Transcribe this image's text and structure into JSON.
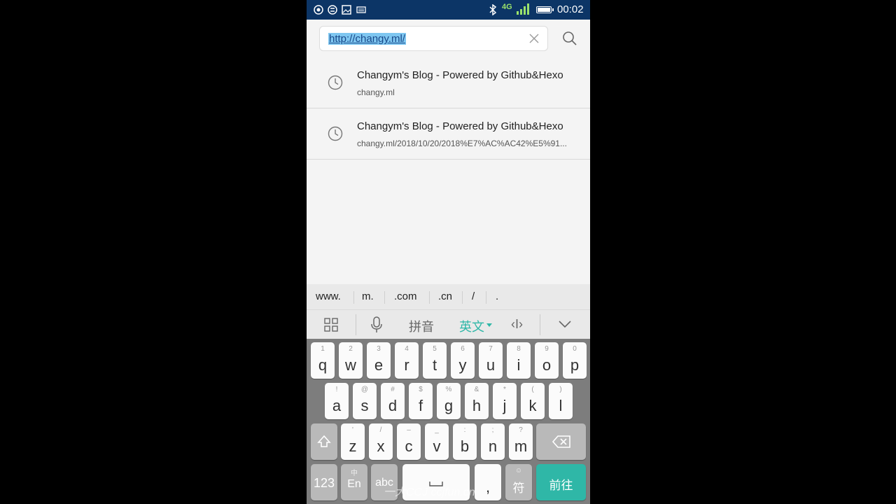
{
  "status_bar": {
    "network": "4G",
    "time": "00:02",
    "battery_level": 1.0
  },
  "address_bar": {
    "url": "http://changy.ml/"
  },
  "suggestions": [
    {
      "title": "Changym's Blog - Powered by Github&Hexo",
      "url": "changy.ml"
    },
    {
      "title": "Changym's Blog - Powered by Github&Hexo",
      "url": "changy.ml/2018/10/20/2018%E7%AC%AC42%E5%91..."
    }
  ],
  "keyboard": {
    "quick_keys": [
      "www.",
      "m.",
      ".com",
      ".cn",
      "/",
      "."
    ],
    "modes": {
      "pinyin": "拼音",
      "english": "英文",
      "cursor": "‹I›"
    },
    "row1": [
      {
        "hint": "1",
        "ch": "q"
      },
      {
        "hint": "2",
        "ch": "w"
      },
      {
        "hint": "3",
        "ch": "e"
      },
      {
        "hint": "4",
        "ch": "r"
      },
      {
        "hint": "5",
        "ch": "t"
      },
      {
        "hint": "6",
        "ch": "y"
      },
      {
        "hint": "7",
        "ch": "u"
      },
      {
        "hint": "8",
        "ch": "i"
      },
      {
        "hint": "9",
        "ch": "o"
      },
      {
        "hint": "0",
        "ch": "p"
      }
    ],
    "row2": [
      {
        "hint": "!",
        "ch": "a"
      },
      {
        "hint": "@",
        "ch": "s"
      },
      {
        "hint": "#",
        "ch": "d"
      },
      {
        "hint": "$",
        "ch": "f"
      },
      {
        "hint": "%",
        "ch": "g"
      },
      {
        "hint": "&",
        "ch": "h"
      },
      {
        "hint": "*",
        "ch": "j"
      },
      {
        "hint": "(",
        "ch": "k"
      },
      {
        "hint": ")",
        "ch": "l"
      }
    ],
    "row3": [
      {
        "hint": "'",
        "ch": "z"
      },
      {
        "hint": "/",
        "ch": "x"
      },
      {
        "hint": "–",
        "ch": "c"
      },
      {
        "hint": "_",
        "ch": "v"
      },
      {
        "hint": ":",
        "ch": "b"
      },
      {
        "hint": ";",
        "ch": "n"
      },
      {
        "hint": "?",
        "ch": "m"
      }
    ],
    "row4": {
      "num": "123",
      "lang_hint": "中",
      "lang": "En",
      "abc": "abc",
      "comma": ",",
      "symbol_hint": "☺",
      "symbol": "符",
      "go": "前往"
    },
    "watermark": "一大CCJ  ccjfun.cn"
  },
  "colors": {
    "status_bar": "#0c3566",
    "accent": "#2fb7a7",
    "url_highlight": "#7ec6f0"
  }
}
